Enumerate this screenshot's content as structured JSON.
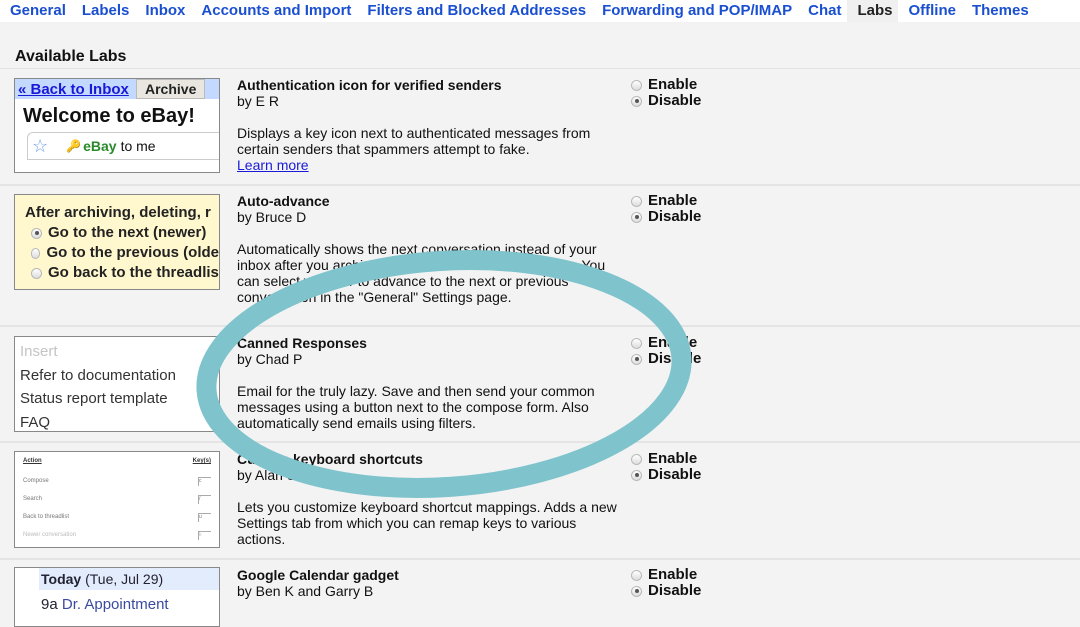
{
  "tabs": [
    {
      "label": "General",
      "active": false
    },
    {
      "label": "Labels",
      "active": false
    },
    {
      "label": "Inbox",
      "active": false
    },
    {
      "label": "Accounts and Import",
      "active": false
    },
    {
      "label": "Filters and Blocked Addresses",
      "active": false
    },
    {
      "label": "Forwarding and POP/IMAP",
      "active": false
    },
    {
      "label": "Chat",
      "active": false
    },
    {
      "label": "Labs",
      "active": true
    },
    {
      "label": "Offline",
      "active": false
    },
    {
      "label": "Themes",
      "active": false
    }
  ],
  "section_title": "Available Labs",
  "options": {
    "enable": "Enable",
    "disable": "Disable"
  },
  "labs": [
    {
      "name": "Authentication icon for verified senders",
      "author": "by E R",
      "description": "Displays a key icon next to authenticated messages from certain senders that spammers attempt to fake.",
      "link": "Learn more",
      "selected": "Disable",
      "preview": {
        "back": "« Back to Inbox",
        "archive": "Archive",
        "welcome": "Welcome to eBay!",
        "sender": "eBay",
        "recipient": "to me"
      }
    },
    {
      "name": "Auto-advance",
      "author": "by Bruce D",
      "description": "Automatically shows the next conversation instead of your inbox after you archive, delete, or mute a conversation. You can select whether to advance to the next or previous conversation in the \"General\" Settings page.",
      "selected": "Disable",
      "preview": {
        "heading": "After archiving, deleting, r",
        "choices": [
          "Go to the next (newer)",
          "Go to the previous (olde",
          "Go back to the threadlis"
        ],
        "checked": 0
      }
    },
    {
      "name": "Canned Responses",
      "author": "by Chad P",
      "description": "Email for the truly lazy. Save and then send your common messages using a button next to the compose form. Also automatically send emails using filters.",
      "selected": "Disable",
      "preview": {
        "items": [
          "Insert",
          "Refer to documentation",
          "Status report template",
          "FAQ"
        ]
      }
    },
    {
      "name": "Custom keyboard shortcuts",
      "author": "by Alan S",
      "description": "Lets you customize keyboard shortcut mappings. Adds a new Settings tab from which you can remap keys to various actions.",
      "selected": "Disable",
      "preview": {
        "col_action": "Action",
        "col_keys": "Key(s)",
        "rows": [
          {
            "action": "Compose",
            "key": "c"
          },
          {
            "action": "Search",
            "key": "/"
          },
          {
            "action": "Back to threadlist",
            "key": "u"
          },
          {
            "action": "Newer conversation",
            "key": "k"
          }
        ]
      }
    },
    {
      "name": "Google Calendar gadget",
      "author": "by Ben K and Garry B",
      "selected": "Disable",
      "preview": {
        "today_label": "Today",
        "today_date": "(Tue, Jul 29)",
        "event_time": "9a",
        "event_title": "Dr. Appointment"
      }
    }
  ],
  "annotation": {
    "shape": "ellipse",
    "color": "#7fc3cc",
    "target": "Canned Responses"
  }
}
